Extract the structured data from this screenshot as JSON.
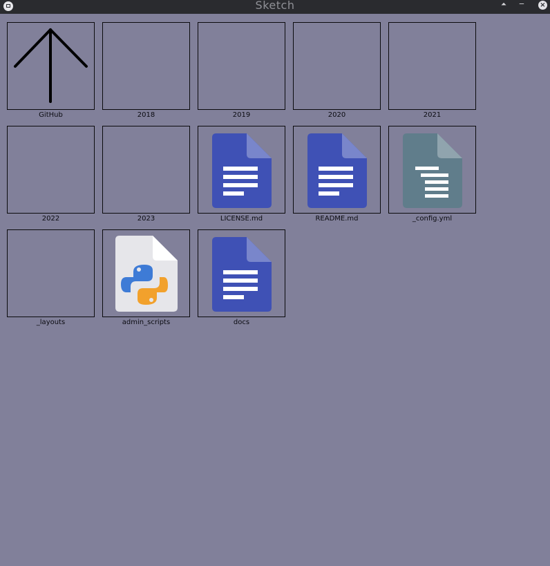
{
  "window": {
    "title": "Sketch",
    "background": "#81809a"
  },
  "titlebar": {
    "app_icon": "app-window-icon",
    "maximize_glyph": "⏶",
    "minimize_glyph": "‒",
    "close_glyph": "×"
  },
  "items": [
    {
      "label": "GitHub",
      "icon": "up-arrow-icon"
    },
    {
      "label": "2018",
      "icon": "folder-icon"
    },
    {
      "label": "2019",
      "icon": "folder-icon"
    },
    {
      "label": "2020",
      "icon": "folder-icon"
    },
    {
      "label": "2021",
      "icon": "folder-icon"
    },
    {
      "label": "2022",
      "icon": "folder-icon"
    },
    {
      "label": "2023",
      "icon": "folder-icon"
    },
    {
      "label": "LICENSE.md",
      "icon": "markdown-document-icon"
    },
    {
      "label": "README.md",
      "icon": "markdown-document-icon"
    },
    {
      "label": "_config.yml",
      "icon": "yaml-document-icon"
    },
    {
      "label": "_layouts",
      "icon": "folder-icon"
    },
    {
      "label": "admin_scripts",
      "icon": "python-file-icon"
    },
    {
      "label": "docs",
      "icon": "markdown-document-icon"
    }
  ],
  "colors": {
    "doc_blue": "#3f51b5",
    "doc_blue_fold": "#7986cb",
    "yaml_teal": "#607d8b",
    "yaml_teal_fold": "#90a4ae",
    "python_blue": "#3e7bd6",
    "python_yellow": "#f2a12c"
  }
}
